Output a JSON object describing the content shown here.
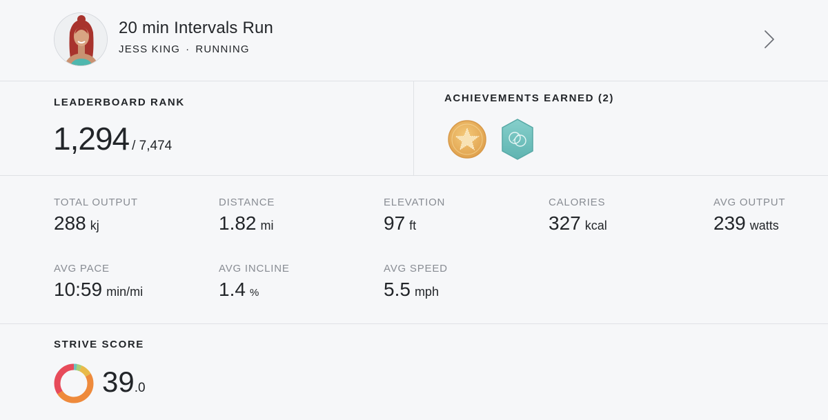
{
  "header": {
    "class_title": "20 min Intervals Run",
    "instructor": "JESS KING",
    "separator": "·",
    "category": "RUNNING"
  },
  "leaderboard": {
    "label": "LEADERBOARD RANK",
    "rank": "1,294",
    "total": "/ 7,474"
  },
  "achievements": {
    "label": "ACHIEVEMENTS EARNED (2)",
    "badges": [
      {
        "icon": "gold-star-badge-icon",
        "color": "#e9b463"
      },
      {
        "icon": "teal-hexagon-badge-icon",
        "color": "#6fc0bd"
      }
    ]
  },
  "metrics": [
    {
      "label": "TOTAL OUTPUT",
      "value": "288",
      "unit": "kj"
    },
    {
      "label": "DISTANCE",
      "value": "1.82",
      "unit": "mi"
    },
    {
      "label": "ELEVATION",
      "value": "97",
      "unit": "ft"
    },
    {
      "label": "CALORIES",
      "value": "327",
      "unit": "kcal"
    },
    {
      "label": "AVG OUTPUT",
      "value": "239",
      "unit": "watts"
    },
    {
      "label": "AVG PACE",
      "value": "10:59",
      "unit": "min/mi"
    },
    {
      "label": "AVG INCLINE",
      "value": "1.4",
      "unit": "%"
    },
    {
      "label": "AVG SPEED",
      "value": "5.5",
      "unit": "mph"
    }
  ],
  "strive": {
    "label": "STRIVE SCORE",
    "score_whole": "39",
    "score_decimal": ".0",
    "zone_colors": [
      "#e8ba4a",
      "#a8cf77",
      "#6fc0bd",
      "#e74b5a",
      "#ee8a3c"
    ]
  },
  "colors": {
    "background": "#f6f7f9",
    "divider": "#dfe1e5",
    "label_gray": "#888c93",
    "text": "#222529"
  }
}
